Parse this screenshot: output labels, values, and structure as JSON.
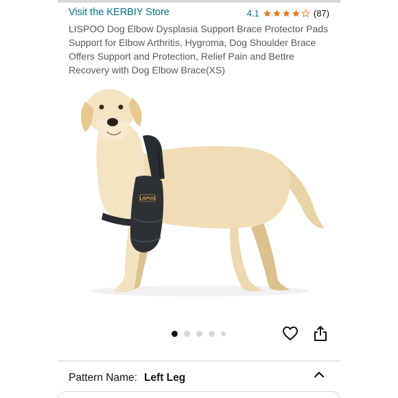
{
  "store": {
    "link_text": "Visit the KERBIY Store"
  },
  "rating": {
    "value": "4.1",
    "stars_filled": 4.1,
    "stars_total": 5,
    "count": "(87)",
    "star_color": "#de7921"
  },
  "product": {
    "title": "LISPOO Dog Elbow Dysplasia Support Brace Protector Pads Support for Elbow Arthritis, Hygroma, Dog Shoulder Brace Offers Support and Protection, Relief Pain and Bettre Recovery with Dog Elbow Brace(XS)",
    "brace_logo": "LISPOO"
  },
  "carousel": {
    "total": 5,
    "active_index": 0
  },
  "actions": {
    "wishlist_icon": "heart-icon",
    "share_icon": "share-icon"
  },
  "variation": {
    "label": "Pattern Name:",
    "value": "Left Leg",
    "toggle_icon": "chevron-up-icon"
  },
  "colors": {
    "link": "#007185",
    "text": "#0f1111",
    "secondary_text": "#565959"
  }
}
